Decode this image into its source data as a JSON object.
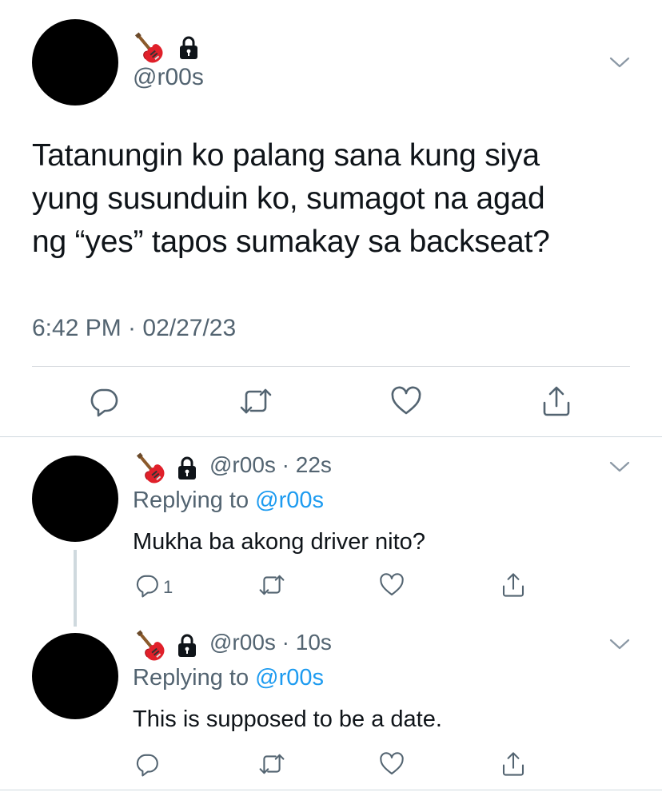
{
  "main_tweet": {
    "display_name_icons": [
      "guitar-icon",
      "lock-icon"
    ],
    "handle": "@r00s",
    "text_lines": [
      "Tatanungin ko palang sana kung siya",
      "yung susunduin ko, sumagot na agad",
      "ng “yes” tapos sumakay sa backseat?"
    ],
    "timestamp": "6:42 PM · 02/27/23",
    "actions": [
      "reply-icon",
      "retweet-icon",
      "like-icon",
      "share-icon"
    ]
  },
  "replies": [
    {
      "display_name_icons": [
        "guitar-icon",
        "lock-icon"
      ],
      "handle_time": "@r00s · 22s",
      "replying_prefix": "Replying to ",
      "replying_mention": "@r00s",
      "text": "Mukha ba akong driver nito?",
      "reply_count": "1"
    },
    {
      "display_name_icons": [
        "guitar-icon",
        "lock-icon"
      ],
      "handle_time": "@r00s · 10s",
      "replying_prefix": "Replying to ",
      "replying_mention": "@r00s",
      "text": "This is supposed to be a date.",
      "reply_count": ""
    }
  ],
  "colors": {
    "text_primary": "#0f1419",
    "text_secondary": "#536471",
    "mention": "#1d9bf0",
    "divider": "#cfd9de"
  }
}
